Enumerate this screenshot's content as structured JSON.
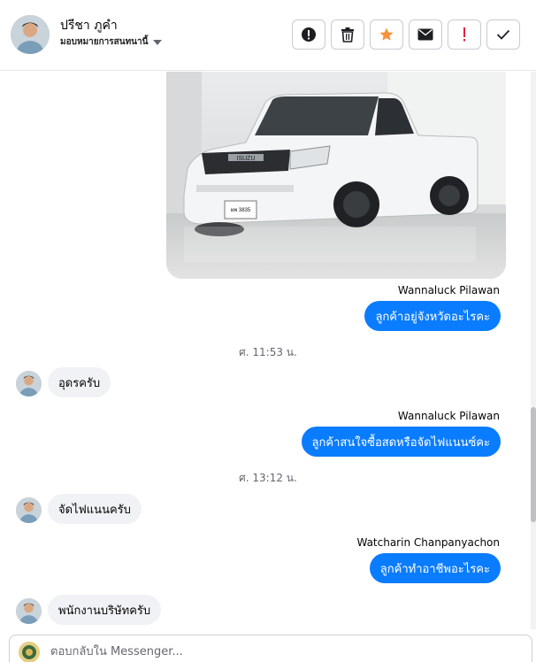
{
  "header": {
    "contact_name": "ปรีชา ภูคำ",
    "assign_label": "มอบหมายการสนทนานี้",
    "actions": [
      {
        "icon": "alert-circle-icon",
        "label": "spam"
      },
      {
        "icon": "trash-icon",
        "label": "delete"
      },
      {
        "icon": "star-icon",
        "label": "star"
      },
      {
        "icon": "envelope-icon",
        "label": "mark unread"
      },
      {
        "icon": "exclamation-icon",
        "label": "follow up"
      },
      {
        "icon": "check-icon",
        "label": "done"
      }
    ]
  },
  "thread": {
    "messages": [
      {
        "type": "image",
        "direction": "out",
        "alt": "white Isuzu pickup truck"
      },
      {
        "type": "sender",
        "text": "Wannaluck Pilawan"
      },
      {
        "type": "text",
        "direction": "out",
        "text": "ลูกค้าอยู่จังหวัดอะไรคะ"
      },
      {
        "type": "timestamp",
        "text": "ศ. 11:53 น."
      },
      {
        "type": "text",
        "direction": "in",
        "text": "อุดรครับ"
      },
      {
        "type": "sender",
        "text": "Wannaluck Pilawan"
      },
      {
        "type": "text",
        "direction": "out",
        "text": "ลูกค้าสนใจซื้อสดหรือจัดไฟแนนซ์คะ"
      },
      {
        "type": "timestamp",
        "text": "ศ. 13:12 น."
      },
      {
        "type": "text",
        "direction": "in",
        "text": "จัดไฟแนนครับ"
      },
      {
        "type": "sender",
        "text": "Watcharin Chanpanyachon"
      },
      {
        "type": "text",
        "direction": "out",
        "text": "ลูกค้าทำอาชีพอะไรคะ"
      },
      {
        "type": "text",
        "direction": "in",
        "text": "พนักงานบริษัทครับ"
      }
    ]
  },
  "composer": {
    "placeholder": "ตอบกลับใน Messenger..."
  },
  "colors": {
    "outgoing_bubble": "#0a7cff",
    "incoming_bubble": "#f0f2f5",
    "star": "#f7923b",
    "exclamation": "#e41e3f"
  }
}
